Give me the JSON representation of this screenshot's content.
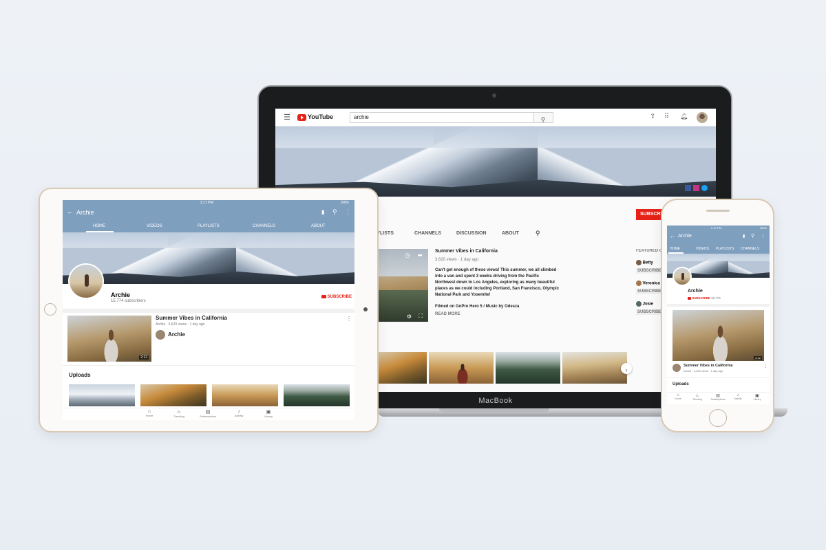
{
  "macbook": {
    "brand_label": "MacBook",
    "topbar": {
      "logo_text": "YouTube",
      "search_value": "archie"
    },
    "tabs": [
      "PLAYLISTS",
      "CHANNELS",
      "DISCUSSION",
      "ABOUT"
    ],
    "subscribe_label": "SUBSCRIBE",
    "featured": {
      "heading": "FEATURED CHANNELS",
      "channels": [
        {
          "name": "Betty",
          "action": "SUBSCRIBE"
        },
        {
          "name": "Veronica",
          "action": "SUBSCRIBE"
        },
        {
          "name": "Josie",
          "action": "SUBSCRIBE"
        }
      ]
    },
    "video": {
      "title": "Summer Vibes in California",
      "meta": "3,620 views · 1 day ago",
      "description": "Can't get enough of these views! This summer, we all climbed into a van and spent 3 weeks driving from the Pacific Northwest down to Los Angeles, exploring as many beautiful places as we could including Portland, San Francisco, Olympic National Park and Yosemite!",
      "credits": "Filmed on GoPro Hero 5 / Music by Odesza",
      "read_more": "READ MORE"
    }
  },
  "ipad": {
    "status_time": "2:17 PM",
    "status_battery": "100%",
    "title": "Archie",
    "tabs": [
      "HOME",
      "VIDEOS",
      "PLAYLISTS",
      "CHANNELS",
      "ABOUT"
    ],
    "channel_name": "Archie",
    "subscribers": "15,774 subscribers",
    "subscribe_label": "SUBSCRIBE",
    "video": {
      "title": "Summer Vibes in California",
      "meta": "Archie · 3,620 views · 1 day ago",
      "uploader": "Archie",
      "duration": "2:12"
    },
    "uploads_heading": "Uploads",
    "bottom_nav": [
      "Home",
      "Trending",
      "Subscriptions",
      "Activity",
      "Library"
    ]
  },
  "iphone": {
    "status_time": "2:17 PM",
    "status_battery": "100%",
    "title": "Archie",
    "tabs": [
      "HOME",
      "VIDEOS",
      "PLAYLISTS",
      "CHANNELS"
    ],
    "channel_name": "Archie",
    "subscribe_label": "SUBSCRIBE",
    "subscriber_count": "15,774",
    "video": {
      "title": "Summer Vibes in California",
      "meta": "Archie · 3,620 views · 1 day ago",
      "duration": "2:12"
    },
    "uploads_heading": "Uploads",
    "bottom_nav": [
      "Home",
      "Trending",
      "Subscriptions",
      "Activity",
      "Library"
    ]
  },
  "colors": {
    "youtube_red": "#e62117",
    "channel_bar": "#7f9fbf"
  }
}
